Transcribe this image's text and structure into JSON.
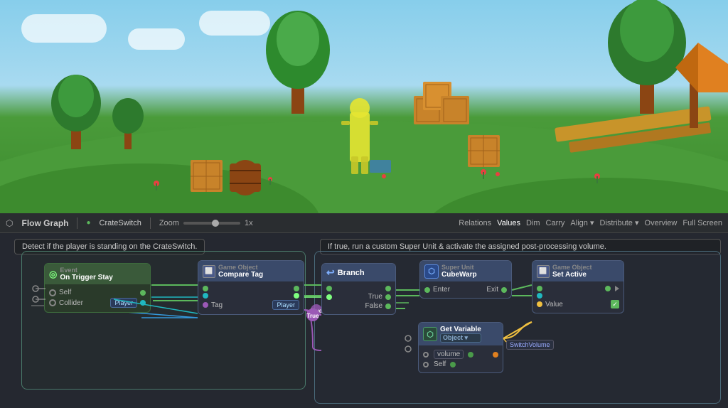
{
  "viewport": {
    "alt": "Game viewport showing low-poly scene"
  },
  "toolbar": {
    "icon": "⬡",
    "title": "Flow Graph",
    "separator": "|",
    "breadcrumb": "CrateSwitch",
    "zoom_label": "Zoom",
    "zoom_value": "1x",
    "buttons": [
      "Relations",
      "Values",
      "Dim",
      "Carry",
      "Align ▾",
      "Distribute ▾",
      "Overview",
      "Full Screen"
    ]
  },
  "canvas": {
    "desc_left": "Detect if the player is standing on the CrateSwitch.",
    "desc_right": "If true, run a custom Super Unit & activate the assigned post-processing volume.",
    "nodes": {
      "trigger": {
        "event_label": "Event",
        "title": "On Trigger Stay",
        "port_self": "Self",
        "port_collider": "Collider",
        "icon": "◉"
      },
      "compare_tag": {
        "subtitle": "Game Object",
        "title": "Compare Tag",
        "port_tag": "Tag",
        "port_tag_value": "Player",
        "icon": "⬜"
      },
      "branch": {
        "title": "Branch",
        "port_true": "True",
        "port_false": "False",
        "icon": "↩"
      },
      "cubewarp": {
        "subtitle": "Super Unit",
        "title": "CubeWarp",
        "port_enter": "Enter",
        "port_exit": "Exit",
        "icon": "⬡"
      },
      "set_active": {
        "subtitle": "Game Object",
        "title": "Set Active",
        "port_value": "Value",
        "icon": "⬜"
      },
      "get_variable": {
        "title": "Get Variable",
        "subtitle": "Object ▾",
        "port_volume": "volume",
        "port_self": "Self",
        "var_label": "SwitchVolume",
        "icon": "⬡"
      }
    }
  }
}
